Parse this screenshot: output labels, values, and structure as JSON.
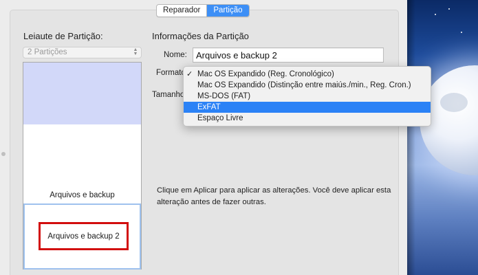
{
  "tabs": [
    {
      "label": "Reparador",
      "active": false
    },
    {
      "label": "Partição",
      "active": true
    }
  ],
  "layout": {
    "title": "Leiaute de Partição:",
    "selected_count": "2 Partições",
    "partitions": [
      {
        "name": "Arquivos e backup"
      },
      {
        "name": "Arquivos e backup 2",
        "selected": true
      }
    ]
  },
  "info": {
    "title": "Informações da Partição",
    "name_label": "Nome:",
    "name_value": "Arquivos e backup 2",
    "format_label": "Formato",
    "size_label": "Tamanho",
    "apply_note": "Clique em Aplicar para aplicar as alterações. Você deve aplicar esta alteração antes de fazer outras."
  },
  "format_menu": {
    "options": [
      {
        "label": "Mac OS Expandido (Reg. Cronológico)",
        "checked": true,
        "highlighted": false
      },
      {
        "label": "Mac OS Expandido (Distinção entre maiús./min., Reg. Cron.)",
        "checked": false,
        "highlighted": false
      },
      {
        "label": "MS-DOS (FAT)",
        "checked": false,
        "highlighted": false
      },
      {
        "label": "ExFAT",
        "checked": false,
        "highlighted": true
      },
      {
        "label": "Espaço Livre",
        "checked": false,
        "highlighted": false
      }
    ]
  },
  "colors": {
    "accent": "#3d8ff6",
    "menu_highlight": "#2b82f6",
    "free_space": "#d2d8f9",
    "annotation_red": "#d20d0d"
  }
}
